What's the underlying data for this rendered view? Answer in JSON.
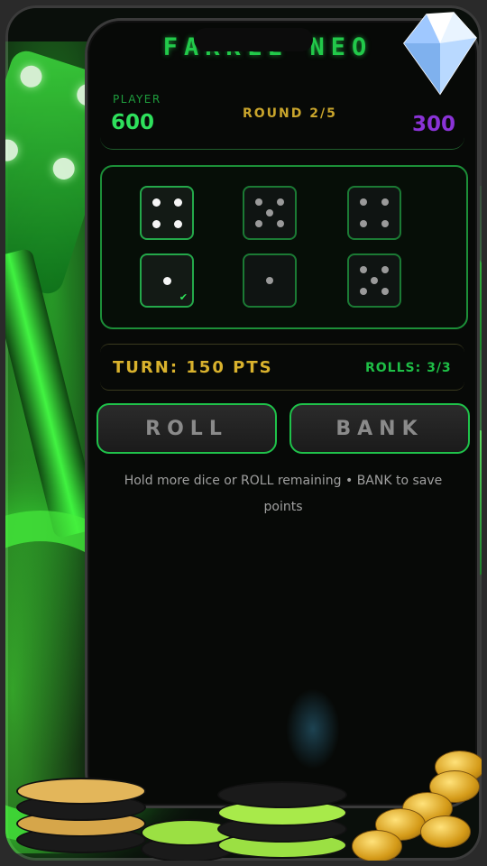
{
  "game": {
    "title": "FARKLE NEO",
    "player_label": "PLAYER",
    "player_score": "600",
    "round": "ROUND 2/5",
    "opponent_score": "300",
    "turn_points": "TURN: 150 PTS",
    "rolls": "ROLLS: 3/3",
    "hint": "Hold more dice or ROLL remaining • BANK to save points"
  },
  "buttons": {
    "roll": "ROLL",
    "bank": "BANK"
  },
  "dice": [
    {
      "value": 4,
      "held": true,
      "checked": false
    },
    {
      "value": 5,
      "held": false,
      "checked": false
    },
    {
      "value": 4,
      "held": false,
      "checked": false
    },
    {
      "value": 1,
      "held": true,
      "checked": true
    },
    {
      "value": 1,
      "held": false,
      "checked": false
    },
    {
      "value": 5,
      "held": false,
      "checked": false
    }
  ],
  "colors": {
    "accent_green": "#22c94a",
    "gold": "#d9b22d",
    "opponent_purple": "#8a33d6"
  }
}
